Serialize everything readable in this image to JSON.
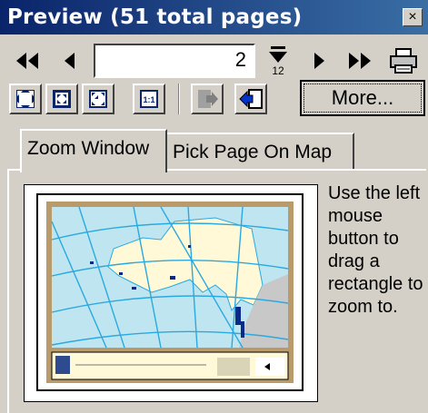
{
  "window": {
    "title": "Preview (51 total pages)",
    "close_glyph": "×"
  },
  "navigation": {
    "current_page": "2",
    "icons": [
      "first-page-icon",
      "previous-page-icon",
      "go-to-page-icon",
      "next-page-icon",
      "last-page-icon",
      "print-icon"
    ]
  },
  "zoom_toolbar": {
    "icons": [
      "zoom-full-extent-icon",
      "zoom-in-icon",
      "zoom-out-icon",
      "zoom-actual-size-icon",
      "export-page-icon",
      "import-page-icon"
    ],
    "actual_size_label": "1:1",
    "more_label": "More..."
  },
  "tabs": [
    {
      "label": "Zoom Window",
      "active": true
    },
    {
      "label": "Pick Page On Map",
      "active": false
    }
  ],
  "instruction": "Use the left mouse button to drag a rectangle to zoom to.",
  "colors": {
    "window_bg": "#d4d0c8",
    "titlebar": "#0a246a",
    "ocean": "#bfe6f0",
    "land": "#fff9d8",
    "map_border": "#b99b6b",
    "grid": "#2aa9e0"
  }
}
